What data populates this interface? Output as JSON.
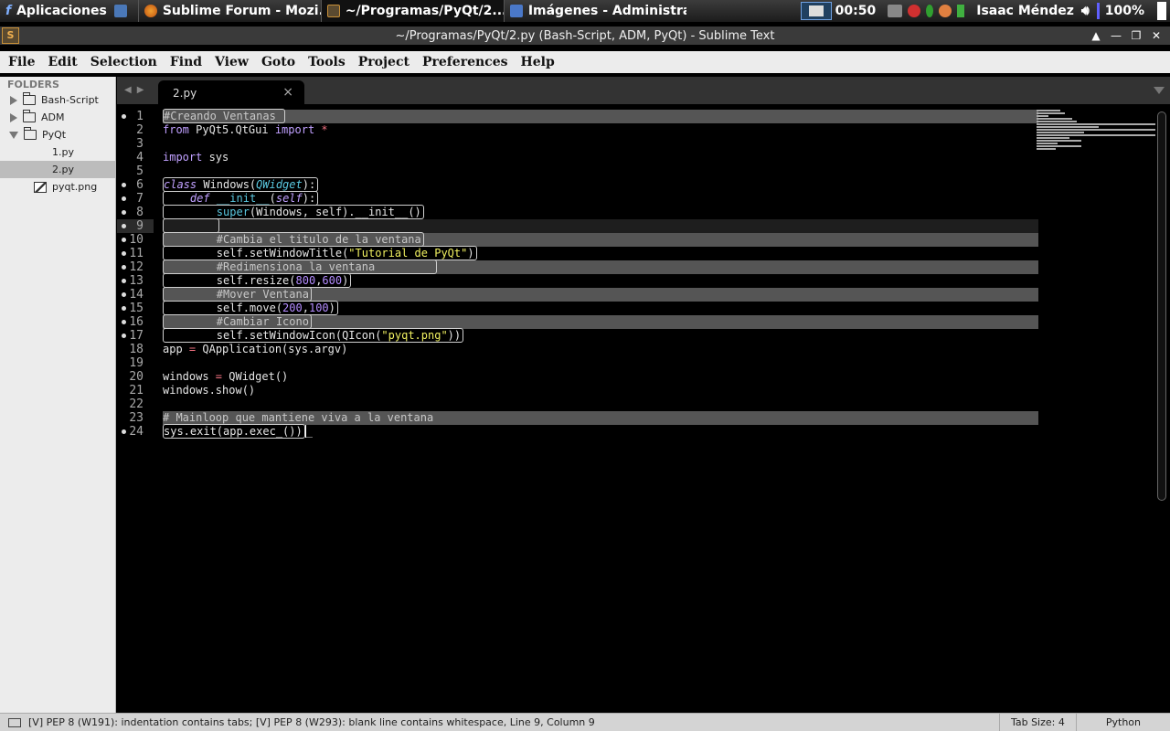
{
  "panel": {
    "apps_label": "Aplicaciones",
    "tasks": [
      {
        "label": "Sublime Forum - Mozi...",
        "icon": "firefox-icon",
        "active": false
      },
      {
        "label": "~/Programas/PyQt/2....",
        "icon": "sublime-text-icon",
        "active": true
      },
      {
        "label": "Imágenes - Administra...",
        "icon": "file-manager-icon",
        "active": false
      }
    ],
    "clock": "00:50",
    "user": "Isaac Méndez",
    "battery": "100%"
  },
  "window": {
    "title": "~/Programas/PyQt/2.py (Bash-Script, ADM, PyQt) - Sublime Text",
    "app_icon_glyph": "S"
  },
  "menu": [
    "File",
    "Edit",
    "Selection",
    "Find",
    "View",
    "Goto",
    "Tools",
    "Project",
    "Preferences",
    "Help"
  ],
  "sidebar": {
    "header": "FOLDERS",
    "folders": [
      "Bash-Script",
      "ADM",
      "PyQt"
    ],
    "files": [
      "1.py",
      "2.py",
      "pyqt.png"
    ]
  },
  "tabs": {
    "active": "2.py",
    "close_glyph": "×"
  },
  "editor": {
    "line_numbers": [
      "1",
      "2",
      "3",
      "4",
      "5",
      "6",
      "7",
      "8",
      "9",
      "10",
      "11",
      "12",
      "13",
      "14",
      "15",
      "16",
      "17",
      "18",
      "19",
      "20",
      "21",
      "22",
      "23",
      "24"
    ],
    "current_line": 9
  },
  "statusbar": {
    "message": "[V] PEP 8 (W191): indentation contains tabs; [V] PEP 8 (W293): blank line contains whitespace, Line 9, Column 9",
    "tab_size": "Tab Size: 4",
    "syntax": "Python"
  },
  "colors": {
    "background": "#000000",
    "keyword": "#c0a0ff",
    "function": "#5ac8e0",
    "string": "#f0f060",
    "number": "#b48cff"
  }
}
